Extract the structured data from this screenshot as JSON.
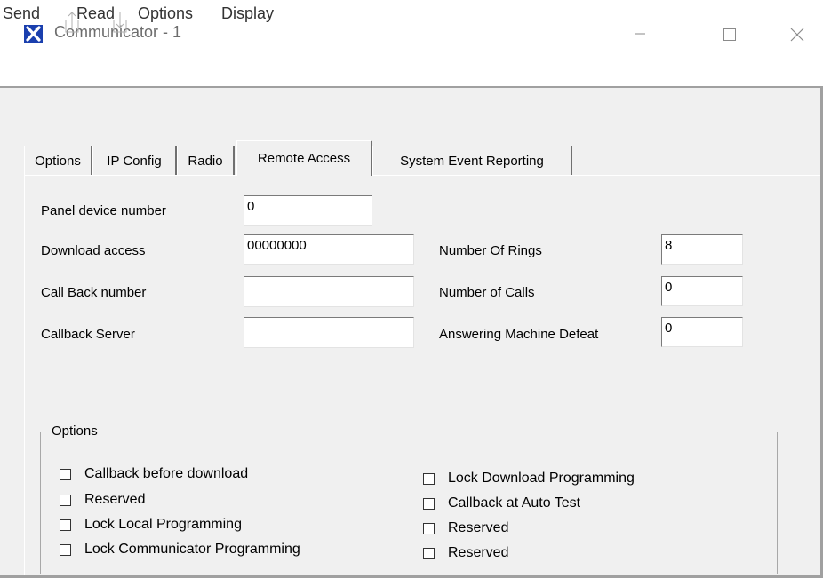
{
  "window": {
    "title": "Communicator - 1",
    "accent_color": "#1a3fae"
  },
  "menu": {
    "items": [
      "Send",
      "Read",
      "Options",
      "Display"
    ]
  },
  "toolbar": {
    "icons": [
      "send-upload-icon",
      "receive-download-icon"
    ]
  },
  "tabs": [
    {
      "label": "Options",
      "active": false
    },
    {
      "label": "IP Config",
      "active": false
    },
    {
      "label": "Radio",
      "active": false
    },
    {
      "label": "Remote Access",
      "active": true
    },
    {
      "label": "System Event Reporting",
      "active": false
    }
  ],
  "remote_access": {
    "panel_device_number": {
      "label": "Panel device number",
      "value": "0"
    },
    "download_access": {
      "label": "Download access",
      "value": "00000000"
    },
    "call_back_number": {
      "label": "Call Back number",
      "value": ""
    },
    "callback_server": {
      "label": "Callback Server",
      "value": ""
    },
    "number_of_rings": {
      "label": "Number Of Rings",
      "value": "8"
    },
    "number_of_calls": {
      "label": "Number of Calls",
      "value": "0"
    },
    "answering_machine_defeat": {
      "label": "Answering Machine Defeat",
      "value": "0"
    }
  },
  "options_group": {
    "title": "Options",
    "left": [
      {
        "label": "Callback before download",
        "checked": false
      },
      {
        "label": "Reserved",
        "checked": false
      },
      {
        "label": "Lock Local Programming",
        "checked": false
      },
      {
        "label": "Lock Communicator Programming",
        "checked": false
      }
    ],
    "right": [
      {
        "label": "Lock Download Programming",
        "checked": false
      },
      {
        "label": "Callback at Auto Test",
        "checked": false
      },
      {
        "label": "Reserved",
        "checked": false
      },
      {
        "label": "Reserved",
        "checked": false
      }
    ]
  }
}
